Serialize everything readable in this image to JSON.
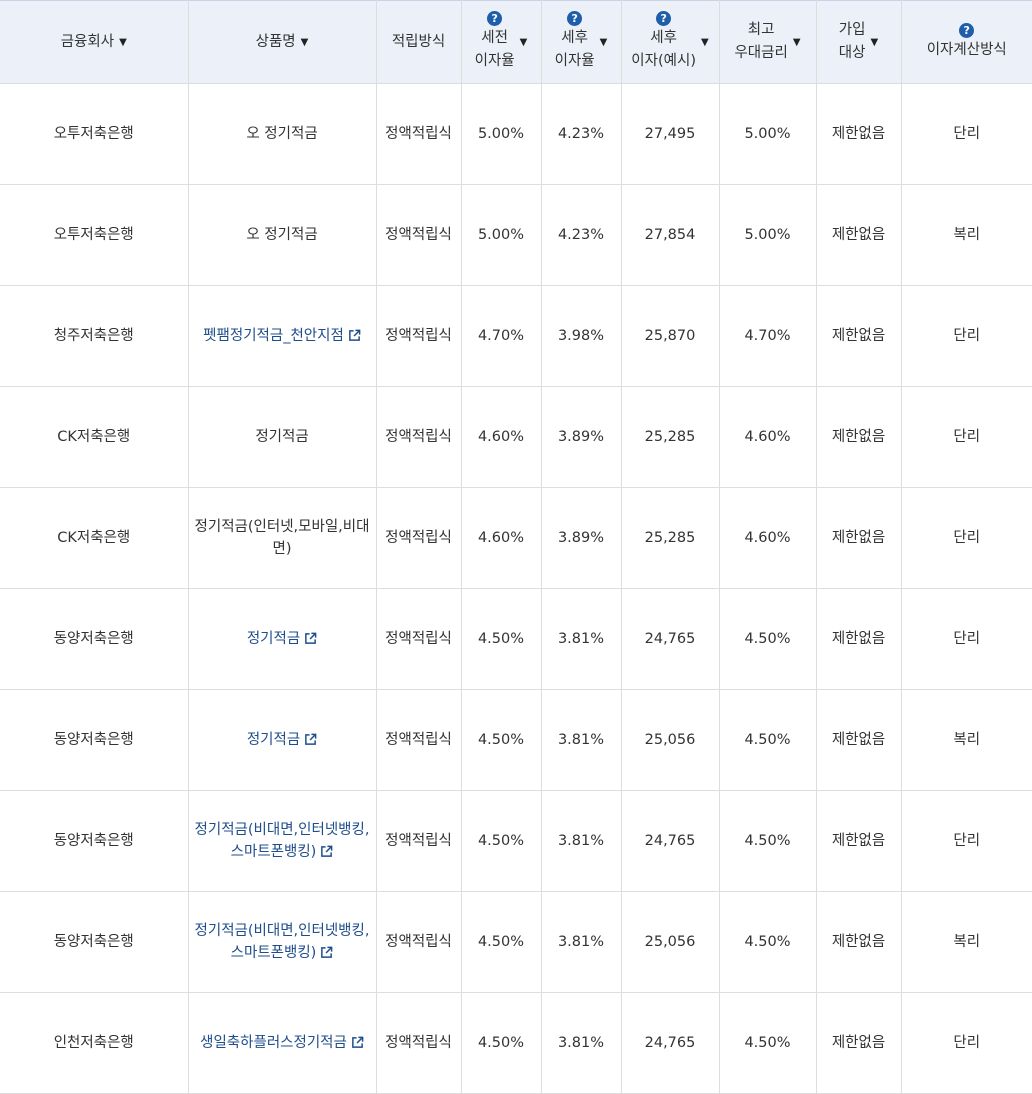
{
  "header": {
    "company": "금융회사",
    "product": "상품명",
    "method": "적립방식",
    "pretax_rate": [
      "세전",
      "이자율"
    ],
    "aftertax_rate": [
      "세후",
      "이자율"
    ],
    "aftertax_interest": [
      "세후",
      "이자(예시)"
    ],
    "max_rate": [
      "최고",
      "우대금리"
    ],
    "eligibility": [
      "가입",
      "대상"
    ],
    "calc_method": "이자계산방식",
    "help_glyph": "?",
    "sort_glyph": "▼"
  },
  "colors": {
    "header_bg": "#ecf1f9",
    "link": "#1f4e8c",
    "help_icon": "#1f5ea8",
    "border": "#dddddd"
  },
  "rows": [
    {
      "company": "오투저축은행",
      "product": "오 정기적금",
      "link": false,
      "method": "정액적립식",
      "pretax": "5.00%",
      "aftertax": "4.23%",
      "interest": "27,495",
      "max": "5.00%",
      "eligibility": "제한없음",
      "calc": "단리"
    },
    {
      "company": "오투저축은행",
      "product": "오 정기적금",
      "link": false,
      "method": "정액적립식",
      "pretax": "5.00%",
      "aftertax": "4.23%",
      "interest": "27,854",
      "max": "5.00%",
      "eligibility": "제한없음",
      "calc": "복리"
    },
    {
      "company": "청주저축은행",
      "product": "펫팸정기적금_천안지점",
      "link": true,
      "method": "정액적립식",
      "pretax": "4.70%",
      "aftertax": "3.98%",
      "interest": "25,870",
      "max": "4.70%",
      "eligibility": "제한없음",
      "calc": "단리"
    },
    {
      "company": "CK저축은행",
      "product": "정기적금",
      "link": false,
      "method": "정액적립식",
      "pretax": "4.60%",
      "aftertax": "3.89%",
      "interest": "25,285",
      "max": "4.60%",
      "eligibility": "제한없음",
      "calc": "단리"
    },
    {
      "company": "CK저축은행",
      "product": "정기적금(인터넷,모바일,비대면)",
      "link": false,
      "method": "정액적립식",
      "pretax": "4.60%",
      "aftertax": "3.89%",
      "interest": "25,285",
      "max": "4.60%",
      "eligibility": "제한없음",
      "calc": "단리"
    },
    {
      "company": "동양저축은행",
      "product": "정기적금",
      "link": true,
      "method": "정액적립식",
      "pretax": "4.50%",
      "aftertax": "3.81%",
      "interest": "24,765",
      "max": "4.50%",
      "eligibility": "제한없음",
      "calc": "단리"
    },
    {
      "company": "동양저축은행",
      "product": "정기적금",
      "link": true,
      "method": "정액적립식",
      "pretax": "4.50%",
      "aftertax": "3.81%",
      "interest": "25,056",
      "max": "4.50%",
      "eligibility": "제한없음",
      "calc": "복리"
    },
    {
      "company": "동양저축은행",
      "product": "정기적금(비대면,인터넷뱅킹,스마트폰뱅킹)",
      "link": true,
      "method": "정액적립식",
      "pretax": "4.50%",
      "aftertax": "3.81%",
      "interest": "24,765",
      "max": "4.50%",
      "eligibility": "제한없음",
      "calc": "단리"
    },
    {
      "company": "동양저축은행",
      "product": "정기적금(비대면,인터넷뱅킹,스마트폰뱅킹)",
      "link": true,
      "method": "정액적립식",
      "pretax": "4.50%",
      "aftertax": "3.81%",
      "interest": "25,056",
      "max": "4.50%",
      "eligibility": "제한없음",
      "calc": "복리"
    },
    {
      "company": "인천저축은행",
      "product": "생일축하플러스정기적금",
      "link": true,
      "method": "정액적립식",
      "pretax": "4.50%",
      "aftertax": "3.81%",
      "interest": "24,765",
      "max": "4.50%",
      "eligibility": "제한없음",
      "calc": "단리"
    }
  ]
}
